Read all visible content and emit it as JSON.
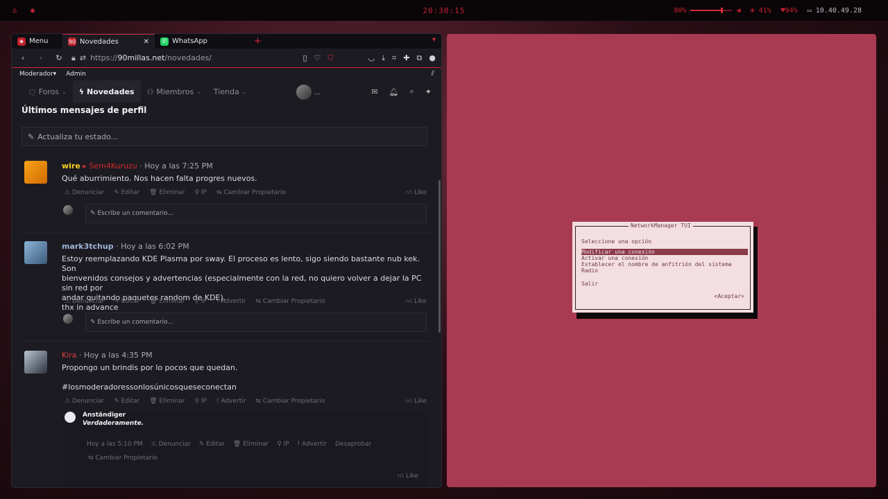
{
  "topbar": {
    "clock": "20:30:15",
    "volume_label": "80%",
    "volume_level": 0.75,
    "cpu_label": "41%",
    "battery_label": "94%",
    "ip_label": "10.40.49.28"
  },
  "browser": {
    "tabs": [
      {
        "label": "Menu"
      },
      {
        "label": "Novedades"
      },
      {
        "label": "WhatsApp"
      }
    ],
    "new_tab_glyph": "+",
    "url_prefix": "https://",
    "url_domain": "90millas.net",
    "url_path": "/novedades/",
    "bookmarks": [
      "Moderador",
      "Admin"
    ],
    "sitenav": [
      "Foros",
      "Novedades",
      "Miembros",
      "Tienda"
    ],
    "avatar_dots": "..."
  },
  "page": {
    "title": "Últimos mensajes de perfil",
    "status_placeholder": "Actualiza tu estado...",
    "comment_placeholder": "Escribe un comentario...",
    "posts": [
      {
        "user": "wire",
        "target": "Sem4Kuruzu",
        "time": "Hoy a las 7:25 PM",
        "body": "Qué aburrimiento. Nos hacen falta progres nuevos.",
        "actions": [
          "Denunciar",
          "Editar",
          "Eliminar",
          "IP",
          "Cambiar Propietario"
        ],
        "like": "Like"
      },
      {
        "user": "mark3tchup",
        "time": "Hoy a las 6:02 PM",
        "body_lines": [
          "Estoy reemplazando KDE Plasma por sway. El proceso es lento, sigo siendo bastante nub kek. Son",
          "bienvenidos consejos y advertencias (especialmente con la red, no quiero volver a dejar la PC sin red por",
          "andar quitando paquetes random de KDE).",
          "thx in advance"
        ],
        "actions": [
          "Denunciar",
          "Editar",
          "Eliminar",
          "IP",
          "Advertir",
          "Cambiar Propietario"
        ],
        "like": "Like"
      },
      {
        "user": "Kira",
        "time": "Hoy a las 4:35 PM",
        "body": "Propongo un brindis por lo pocos que quedan.",
        "hashtag": "#losmoderadoressonlosúnicosqueseconectan",
        "actions": [
          "Denunciar",
          "Editar",
          "Eliminar",
          "IP",
          "Advertir",
          "Cambiar Propietario"
        ],
        "like": "Like"
      }
    ],
    "reply": {
      "user": "Anständiger",
      "text": "Verdaderamente.",
      "time": "Hoy a las 5:10 PM",
      "actions": [
        "Denunciar",
        "Editar",
        "Eliminar",
        "IP",
        "Advertir",
        "Desaprobar"
      ],
      "action_extra": "Cambiar Propietario",
      "like": "Like"
    }
  },
  "nmtui": {
    "title": "NetworkManager TUI",
    "prompt": "Seleccione una opción",
    "options": [
      "Modificar una conexión",
      "Activar una conexión",
      "Establecer el nombre de anfitrión del sistema",
      "Radio",
      "Salir"
    ],
    "selected_index": 0,
    "ok_label": "<Aceptar>"
  },
  "colors": {
    "accent": "#d8293b",
    "terminal_bg": "#a83a52",
    "dialog_bg": "#f3dfe1"
  }
}
